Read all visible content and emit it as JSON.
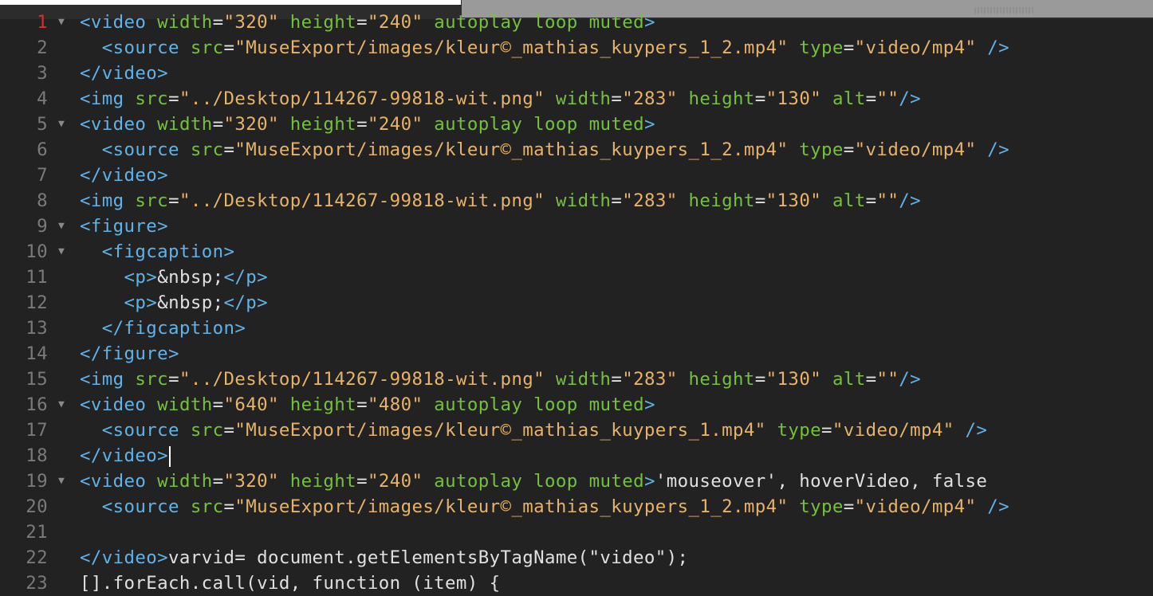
{
  "editor": {
    "cursor_line": 18,
    "current_line": 1,
    "lines": [
      {
        "n": "1",
        "fold": true,
        "indent": 0,
        "tokens": [
          {
            "t": "<video",
            "c": "tag"
          },
          {
            "t": " width",
            "c": "attr"
          },
          {
            "t": "=",
            "c": "eq"
          },
          {
            "t": "\"320\"",
            "c": "str"
          },
          {
            "t": " height",
            "c": "attr"
          },
          {
            "t": "=",
            "c": "eq"
          },
          {
            "t": "\"240\"",
            "c": "str"
          },
          {
            "t": " autoplay loop muted",
            "c": "attr"
          },
          {
            "t": ">",
            "c": "tag"
          }
        ]
      },
      {
        "n": "2",
        "fold": false,
        "indent": 2,
        "tokens": [
          {
            "t": "<source",
            "c": "tag"
          },
          {
            "t": " src",
            "c": "attr"
          },
          {
            "t": "=",
            "c": "eq"
          },
          {
            "t": "\"MuseExport/images/kleur©_mathias_kuypers_1_2.mp4\"",
            "c": "str"
          },
          {
            "t": " type",
            "c": "attr"
          },
          {
            "t": "=",
            "c": "eq"
          },
          {
            "t": "\"video/mp4\"",
            "c": "str"
          },
          {
            "t": " />",
            "c": "tag"
          }
        ]
      },
      {
        "n": "3",
        "fold": false,
        "indent": 0,
        "tokens": [
          {
            "t": "</video>",
            "c": "tag"
          }
        ]
      },
      {
        "n": "4",
        "fold": false,
        "indent": 0,
        "tokens": [
          {
            "t": "<img",
            "c": "tag"
          },
          {
            "t": " src",
            "c": "attr"
          },
          {
            "t": "=",
            "c": "eq"
          },
          {
            "t": "\"../Desktop/114267-99818-wit.png\"",
            "c": "str"
          },
          {
            "t": " width",
            "c": "attr"
          },
          {
            "t": "=",
            "c": "eq"
          },
          {
            "t": "\"283\"",
            "c": "str"
          },
          {
            "t": " height",
            "c": "attr"
          },
          {
            "t": "=",
            "c": "eq"
          },
          {
            "t": "\"130\"",
            "c": "str"
          },
          {
            "t": " alt",
            "c": "attr"
          },
          {
            "t": "=",
            "c": "eq"
          },
          {
            "t": "\"\"",
            "c": "str"
          },
          {
            "t": "/>",
            "c": "tag"
          }
        ]
      },
      {
        "n": "5",
        "fold": true,
        "indent": 0,
        "tokens": [
          {
            "t": "<video",
            "c": "tag"
          },
          {
            "t": " width",
            "c": "attr"
          },
          {
            "t": "=",
            "c": "eq"
          },
          {
            "t": "\"320\"",
            "c": "str"
          },
          {
            "t": " height",
            "c": "attr"
          },
          {
            "t": "=",
            "c": "eq"
          },
          {
            "t": "\"240\"",
            "c": "str"
          },
          {
            "t": " autoplay loop muted",
            "c": "attr"
          },
          {
            "t": ">",
            "c": "tag"
          }
        ]
      },
      {
        "n": "6",
        "fold": false,
        "indent": 2,
        "tokens": [
          {
            "t": "<source",
            "c": "tag"
          },
          {
            "t": " src",
            "c": "attr"
          },
          {
            "t": "=",
            "c": "eq"
          },
          {
            "t": "\"MuseExport/images/kleur©_mathias_kuypers_1_2.mp4\"",
            "c": "str"
          },
          {
            "t": " type",
            "c": "attr"
          },
          {
            "t": "=",
            "c": "eq"
          },
          {
            "t": "\"video/mp4\"",
            "c": "str"
          },
          {
            "t": " />",
            "c": "tag"
          }
        ]
      },
      {
        "n": "7",
        "fold": false,
        "indent": 0,
        "tokens": [
          {
            "t": "</video>",
            "c": "tag"
          }
        ]
      },
      {
        "n": "8",
        "fold": false,
        "indent": 0,
        "tokens": [
          {
            "t": "<img",
            "c": "tag"
          },
          {
            "t": " src",
            "c": "attr"
          },
          {
            "t": "=",
            "c": "eq"
          },
          {
            "t": "\"../Desktop/114267-99818-wit.png\"",
            "c": "str"
          },
          {
            "t": " width",
            "c": "attr"
          },
          {
            "t": "=",
            "c": "eq"
          },
          {
            "t": "\"283\"",
            "c": "str"
          },
          {
            "t": " height",
            "c": "attr"
          },
          {
            "t": "=",
            "c": "eq"
          },
          {
            "t": "\"130\"",
            "c": "str"
          },
          {
            "t": " alt",
            "c": "attr"
          },
          {
            "t": "=",
            "c": "eq"
          },
          {
            "t": "\"\"",
            "c": "str"
          },
          {
            "t": "/>",
            "c": "tag"
          }
        ]
      },
      {
        "n": "9",
        "fold": true,
        "indent": 0,
        "tokens": [
          {
            "t": "<figure>",
            "c": "tag"
          }
        ]
      },
      {
        "n": "10",
        "fold": true,
        "indent": 2,
        "tokens": [
          {
            "t": "<figcaption>",
            "c": "tag"
          }
        ]
      },
      {
        "n": "11",
        "fold": false,
        "indent": 4,
        "tokens": [
          {
            "t": "<p>",
            "c": "tag"
          },
          {
            "t": "&nbsp;",
            "c": "txt"
          },
          {
            "t": "</p>",
            "c": "tag"
          }
        ]
      },
      {
        "n": "12",
        "fold": false,
        "indent": 4,
        "tokens": [
          {
            "t": "<p>",
            "c": "tag"
          },
          {
            "t": "&nbsp;",
            "c": "txt"
          },
          {
            "t": "</p>",
            "c": "tag"
          }
        ]
      },
      {
        "n": "13",
        "fold": false,
        "indent": 2,
        "tokens": [
          {
            "t": "</figcaption>",
            "c": "tag"
          }
        ]
      },
      {
        "n": "14",
        "fold": false,
        "indent": 0,
        "tokens": [
          {
            "t": "</figure>",
            "c": "tag"
          }
        ]
      },
      {
        "n": "15",
        "fold": false,
        "indent": 0,
        "tokens": [
          {
            "t": "<img",
            "c": "tag"
          },
          {
            "t": " src",
            "c": "attr"
          },
          {
            "t": "=",
            "c": "eq"
          },
          {
            "t": "\"../Desktop/114267-99818-wit.png\"",
            "c": "str"
          },
          {
            "t": " width",
            "c": "attr"
          },
          {
            "t": "=",
            "c": "eq"
          },
          {
            "t": "\"283\"",
            "c": "str"
          },
          {
            "t": " height",
            "c": "attr"
          },
          {
            "t": "=",
            "c": "eq"
          },
          {
            "t": "\"130\"",
            "c": "str"
          },
          {
            "t": " alt",
            "c": "attr"
          },
          {
            "t": "=",
            "c": "eq"
          },
          {
            "t": "\"\"",
            "c": "str"
          },
          {
            "t": "/>",
            "c": "tag"
          }
        ]
      },
      {
        "n": "16",
        "fold": true,
        "indent": 0,
        "tokens": [
          {
            "t": "<video",
            "c": "tag"
          },
          {
            "t": " width",
            "c": "attr"
          },
          {
            "t": "=",
            "c": "eq"
          },
          {
            "t": "\"640\"",
            "c": "str"
          },
          {
            "t": " height",
            "c": "attr"
          },
          {
            "t": "=",
            "c": "eq"
          },
          {
            "t": "\"480\"",
            "c": "str"
          },
          {
            "t": " autoplay loop muted",
            "c": "attr"
          },
          {
            "t": ">",
            "c": "tag"
          }
        ]
      },
      {
        "n": "17",
        "fold": false,
        "indent": 2,
        "tokens": [
          {
            "t": "<source",
            "c": "tag"
          },
          {
            "t": " src",
            "c": "attr"
          },
          {
            "t": "=",
            "c": "eq"
          },
          {
            "t": "\"MuseExport/images/kleur©_mathias_kuypers_1.mp4\"",
            "c": "str"
          },
          {
            "t": " type",
            "c": "attr"
          },
          {
            "t": "=",
            "c": "eq"
          },
          {
            "t": "\"video/mp4\"",
            "c": "str"
          },
          {
            "t": " />",
            "c": "tag"
          }
        ]
      },
      {
        "n": "18",
        "fold": false,
        "indent": 0,
        "tokens": [
          {
            "t": "</video>",
            "c": "tag"
          }
        ]
      },
      {
        "n": "19",
        "fold": true,
        "indent": 0,
        "tokens": [
          {
            "t": "<video",
            "c": "tag"
          },
          {
            "t": " width",
            "c": "attr"
          },
          {
            "t": "=",
            "c": "eq"
          },
          {
            "t": "\"320\"",
            "c": "str"
          },
          {
            "t": " height",
            "c": "attr"
          },
          {
            "t": "=",
            "c": "eq"
          },
          {
            "t": "\"240\"",
            "c": "str"
          },
          {
            "t": " autoplay loop muted",
            "c": "attr"
          },
          {
            "t": ">",
            "c": "tag"
          },
          {
            "t": "'mouseover', hoverVideo, false",
            "c": "txt"
          }
        ]
      },
      {
        "n": "20",
        "fold": false,
        "indent": 2,
        "tokens": [
          {
            "t": "<source",
            "c": "tag"
          },
          {
            "t": " src",
            "c": "attr"
          },
          {
            "t": "=",
            "c": "eq"
          },
          {
            "t": "\"MuseExport/images/kleur©_mathias_kuypers_1_2.mp4\"",
            "c": "str"
          },
          {
            "t": " type",
            "c": "attr"
          },
          {
            "t": "=",
            "c": "eq"
          },
          {
            "t": "\"video/mp4\"",
            "c": "str"
          },
          {
            "t": " />",
            "c": "tag"
          }
        ]
      },
      {
        "n": "21",
        "fold": false,
        "indent": 0,
        "tokens": []
      },
      {
        "n": "22",
        "fold": false,
        "indent": 0,
        "tokens": [
          {
            "t": "</video>",
            "c": "tag"
          },
          {
            "t": "varvid= document.getElementsByTagName(\"video\");",
            "c": "txt"
          }
        ]
      },
      {
        "n": "23",
        "fold": false,
        "indent": 0,
        "tokens": [
          {
            "t": "[].forEach.call(vid, function (item) {",
            "c": "txt"
          }
        ]
      }
    ]
  },
  "colors": {
    "background": "#222222",
    "tag": "#5fb3e8",
    "attribute": "#74c13b",
    "string": "#e6b368",
    "text": "#e0e0e0",
    "line_number": "#7a7a7a",
    "current_line_number": "#d6302b"
  },
  "icons": {
    "fold": "fold-triangle-icon"
  }
}
